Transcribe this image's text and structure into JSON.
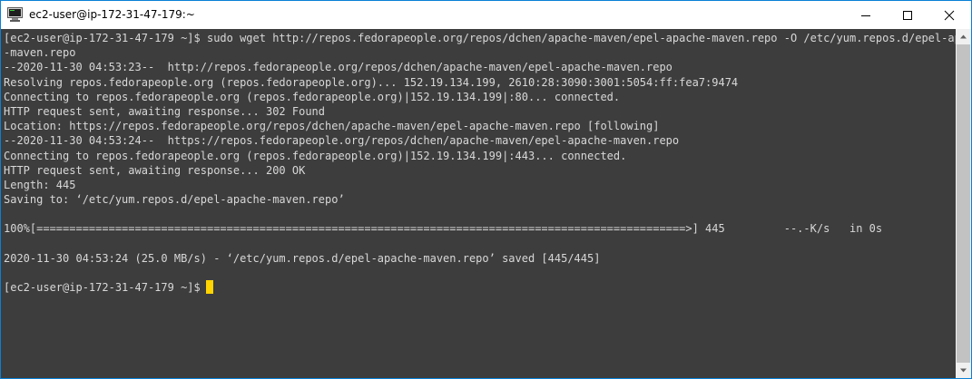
{
  "window": {
    "title": "ec2-user@ip-172-31-47-179:~",
    "icon": "putty-terminal-icon",
    "controls": [
      "minimize-icon",
      "maximize-icon",
      "close-icon"
    ]
  },
  "terminal": {
    "lines": [
      "[ec2-user@ip-172-31-47-179 ~]$ sudo wget http://repos.fedorapeople.org/repos/dchen/apache-maven/epel-apache-maven.repo -O /etc/yum.repos.d/epel-apache",
      "-maven.repo",
      "--2020-11-30 04:53:23--  http://repos.fedorapeople.org/repos/dchen/apache-maven/epel-apache-maven.repo",
      "Resolving repos.fedorapeople.org (repos.fedorapeople.org)... 152.19.134.199, 2610:28:3090:3001:5054:ff:fea7:9474",
      "Connecting to repos.fedorapeople.org (repos.fedorapeople.org)|152.19.134.199|:80... connected.",
      "HTTP request sent, awaiting response... 302 Found",
      "Location: https://repos.fedorapeople.org/repos/dchen/apache-maven/epel-apache-maven.repo [following]",
      "--2020-11-30 04:53:24--  https://repos.fedorapeople.org/repos/dchen/apache-maven/epel-apache-maven.repo",
      "Connecting to repos.fedorapeople.org (repos.fedorapeople.org)|152.19.134.199|:443... connected.",
      "HTTP request sent, awaiting response... 200 OK",
      "Length: 445",
      "Saving to: ‘/etc/yum.repos.d/epel-apache-maven.repo’",
      "",
      "100%[===================================================================================================>] 445         --.-K/s   in 0s",
      "",
      "2020-11-30 04:53:24 (25.0 MB/s) - ‘/etc/yum.repos.d/epel-apache-maven.repo’ saved [445/445]",
      ""
    ],
    "prompt": "[ec2-user@ip-172-31-47-179 ~]$",
    "colors": {
      "background": "#3d3d3d",
      "foreground": "#d8d8d8",
      "cursor": "#ffd400"
    }
  },
  "scrollbar": {
    "up_icon": "scroll-up-arrow-icon",
    "down_icon": "scroll-down-arrow-icon"
  }
}
